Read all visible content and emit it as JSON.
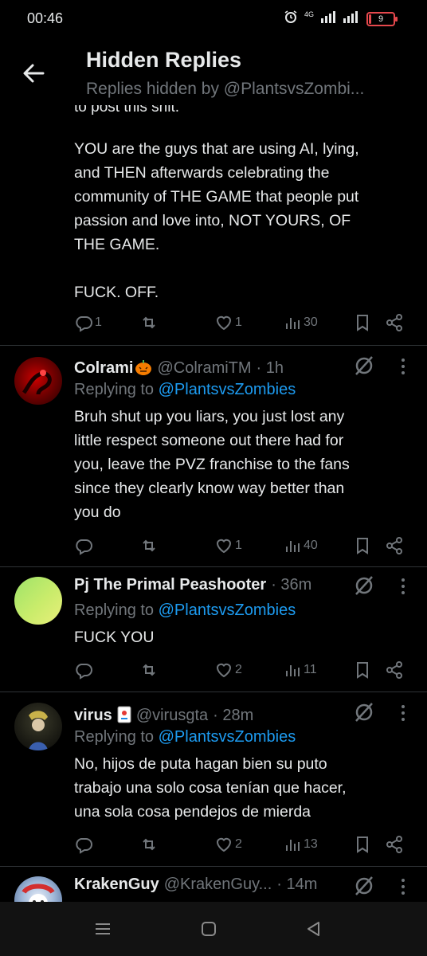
{
  "status_bar": {
    "time": "00:46",
    "network": "4G",
    "battery": "9",
    "battery_level": 0.09
  },
  "header": {
    "title": "Hidden Replies",
    "subtitle": "Replies hidden by @PlantsvsZombi..."
  },
  "posts": [
    {
      "clipped_text": "to post this shit.",
      "body": "YOU are the guys that are using AI, lying,\nand THEN afterwards celebrating the\ncommunity of THE GAME that people put\npassion and love into, NOT YOURS, OF\nTHE GAME.\n\nFUCK. OFF.",
      "stats": {
        "replies": "1",
        "retweets": "",
        "likes": "1",
        "views": "30"
      }
    },
    {
      "display_name": "Colrami",
      "handle": "@ColramiTM",
      "time": "· 1h",
      "replying_prefix": "Replying to",
      "replying_to": "@PlantsvsZombies",
      "body": "Bruh shut up you liars, you just lost any\nlittle respect someone out there had for\nyou, leave the PVZ franchise to the fans\nsince they clearly know way better than\nyou do",
      "stats": {
        "replies": "",
        "retweets": "",
        "likes": "1",
        "views": "40"
      }
    },
    {
      "display_name": "Pj The Primal Peashooter",
      "handle": "",
      "time": "· 36m",
      "replying_prefix": "Replying to",
      "replying_to": "@PlantsvsZombies",
      "body": "FUCK YOU",
      "stats": {
        "replies": "",
        "retweets": "",
        "likes": "2",
        "views": "11"
      }
    },
    {
      "display_name": "virus",
      "handle": "@virusgta",
      "time": "· 28m",
      "replying_prefix": "Replying to",
      "replying_to": "@PlantsvsZombies",
      "body": "No, hijos de puta hagan bien su puto\ntrabajo una solo cosa tenían que hacer,\nuna sola cosa pendejos de mierda",
      "stats": {
        "replies": "",
        "retweets": "",
        "likes": "2",
        "views": "13"
      }
    },
    {
      "display_name": "KrakenGuy",
      "handle": "@KrakenGuy...",
      "time": "· 14m"
    }
  ],
  "colors": {
    "background": "#000000",
    "text": "#e7e9ea",
    "muted": "#71767b",
    "link": "#1d9bf0",
    "divider": "#2f3336"
  }
}
